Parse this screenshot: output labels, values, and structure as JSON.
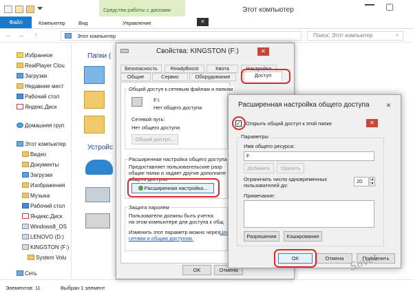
{
  "explorer": {
    "window_title": "Этот компьютер",
    "context_tab_group": "Средства работы с дисками",
    "ribbon_tabs": [
      "Файл",
      "Компьютер",
      "Вид",
      "Управление"
    ],
    "address": "Этот компьютер",
    "search_placeholder": "Поиск: Этот компьютер",
    "content_partial_labels": [
      "Папки (",
      "Устройс"
    ],
    "nav_items": [
      {
        "label": "Избранное",
        "group": true
      },
      {
        "label": "RealPlayer Clou"
      },
      {
        "label": "Загрузки"
      },
      {
        "label": "Недавние мест"
      },
      {
        "label": "Рабочий стол"
      },
      {
        "label": "Яндекс.Диск"
      },
      {
        "label": "Домашняя груп",
        "group": true
      },
      {
        "label": "Этот компьютер",
        "group": true
      },
      {
        "label": "Видео"
      },
      {
        "label": "Документы"
      },
      {
        "label": "Загрузки"
      },
      {
        "label": "Изображения"
      },
      {
        "label": "Музыка"
      },
      {
        "label": "Рабочий стол"
      },
      {
        "label": "Яндекс.Диск"
      },
      {
        "label": "Windows8_OS"
      },
      {
        "label": "LENOVO (D:)"
      },
      {
        "label": "KINGSTON (F:)"
      },
      {
        "label": "System Volu"
      },
      {
        "label": "Сеть",
        "group": true
      }
    ],
    "status_items": "Элементов: 11",
    "status_selected": "Выбран 1 элемент"
  },
  "properties_dialog": {
    "title": "Свойства: KINGSTON (F:)",
    "tabs_row1": [
      "Безопасность",
      "ReadyBoost",
      "Квота",
      "Настройка"
    ],
    "tabs_row2": [
      "Общие",
      "Сервис",
      "Оборудование",
      "Доступ"
    ],
    "share_section_title": "Общий доступ к сетевым файлам и папкам",
    "drive_name": "F:\\",
    "share_status": "Нет общего доступа",
    "network_path_label": "Сетевой путь:",
    "network_path_value": "Нет общего доступа",
    "share_button": "Общий доступ...",
    "advanced_section_title": "Расширенная настройка общего доступа",
    "advanced_desc": [
      "Предоставляет пользовательские разр",
      "общие папки и задает другие дополните",
      "общего доступа."
    ],
    "advanced_button": "Расширенная настройка...",
    "password_section_title": "Защита паролем",
    "password_desc": [
      "Пользователи должны быть учетна",
      "на этом компьютере для доступа к общ"
    ],
    "password_link_prefix": "Изменить этот параметр можно через",
    "password_link": [
      "Центр",
      "сетями и общим доступом."
    ],
    "ok": "OK",
    "cancel": "Отмена"
  },
  "advanced_dialog": {
    "title": "Расширенная настройка общего доступа",
    "share_checkbox": "Открыть общий доступ к этой папке",
    "share_checked": true,
    "params_label": "Параметры",
    "share_name_label": "Имя общего ресурса:",
    "share_name_value": "F",
    "add_button": "Добавить",
    "delete_button": "Удалить",
    "limit_label": [
      "Ограничить число одновременных",
      "пользователей до:"
    ],
    "limit_value": "20",
    "note_label": "Примечание:",
    "permissions_button": "Разрешения",
    "caching_button": "Кэширование",
    "ok": "ОК",
    "cancel": "Отмена",
    "apply": "Применить"
  },
  "watermark": "Sovet",
  "colors": {
    "file_tab": "#1979ca",
    "context_tab": "#dfeec7",
    "highlight": "#e0262b",
    "close": "#c9463d",
    "link": "#1a5fb4"
  }
}
